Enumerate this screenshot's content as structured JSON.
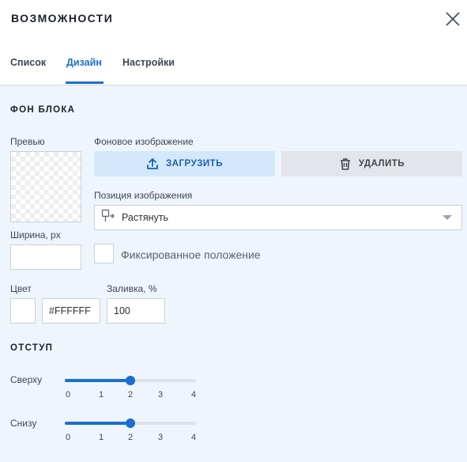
{
  "header": {
    "title": "ВОЗМОЖНОСТИ",
    "close_icon": "close-icon",
    "tabs": [
      {
        "label": "Список",
        "active": false
      },
      {
        "label": "Дизайн",
        "active": true
      },
      {
        "label": "Настройки",
        "active": false
      }
    ]
  },
  "background_section": {
    "title": "ФОН БЛОКА",
    "preview_label": "Превью",
    "image_label": "Фоновое изображение",
    "upload_label": "ЗАГРУЗИТЬ",
    "upload_icon": "upload-icon",
    "delete_label": "УДАЛИТЬ",
    "delete_icon": "trash-icon",
    "position_label": "Позиция изображения",
    "position_value": "Растянуть",
    "position_icon": "stretch-icon",
    "width_label": "Ширина, px",
    "width_value": "",
    "fixed_label": "Фиксированное положение",
    "fixed_checked": false,
    "color_label": "Цвет",
    "color_value": "#FFFFFF",
    "fill_label": "Заливка, %",
    "fill_value": "100"
  },
  "padding_section": {
    "title": "ОТСТУП",
    "sliders": [
      {
        "label": "Сверху",
        "value": 2,
        "min": 0,
        "max": 4,
        "ticks": [
          "0",
          "1",
          "2",
          "3",
          "4"
        ]
      },
      {
        "label": "Снизу",
        "value": 2,
        "min": 0,
        "max": 4,
        "ticks": [
          "0",
          "1",
          "2",
          "3",
          "4"
        ]
      }
    ]
  },
  "colors": {
    "accent": "#1a6fd0",
    "panel_bg": "#eef5fd",
    "upload_bg": "#d4e8fb",
    "delete_bg": "#e2e5ea"
  }
}
